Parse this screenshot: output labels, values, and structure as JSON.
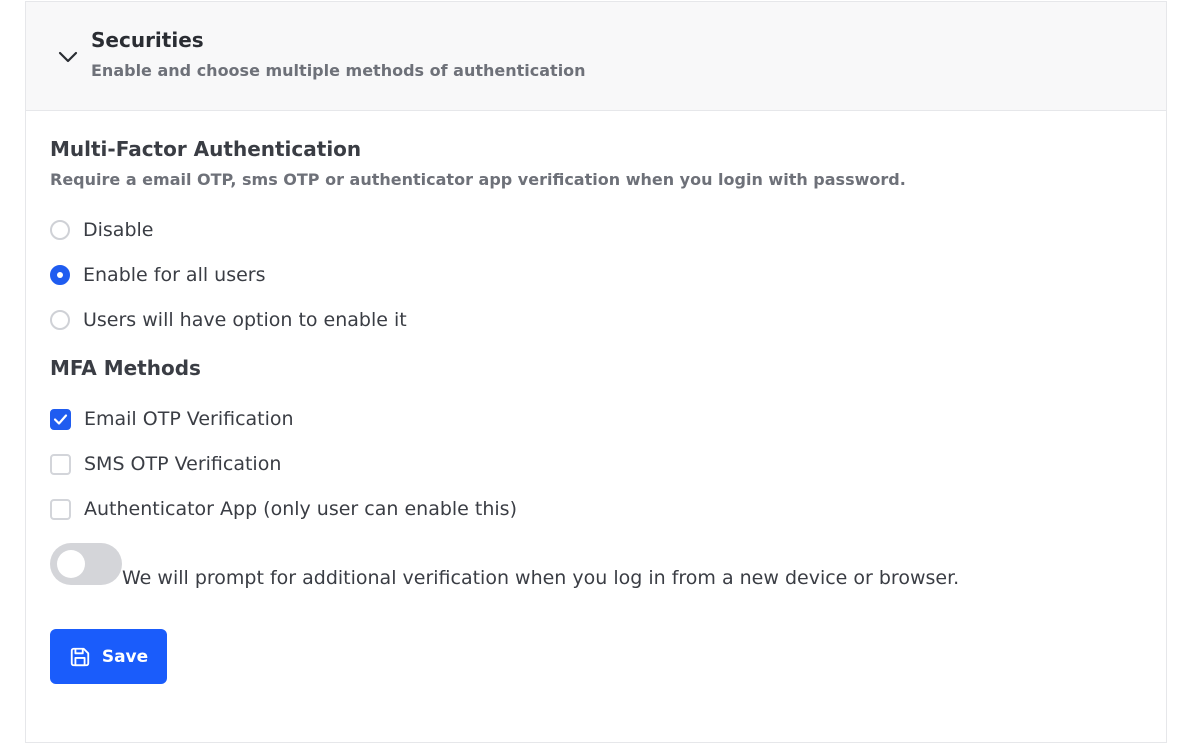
{
  "header": {
    "title": "Securities",
    "subtitle": "Enable and choose multiple methods of authentication",
    "icon": "chevron-down-icon"
  },
  "mfa": {
    "title": "Multi-Factor Authentication",
    "description": "Require a email OTP, sms OTP or authenticator app verification when you login with password.",
    "options": [
      {
        "label": "Disable",
        "selected": false
      },
      {
        "label": "Enable for all users",
        "selected": true
      },
      {
        "label": "Users will have option to enable it",
        "selected": false
      }
    ]
  },
  "methods": {
    "title": "MFA Methods",
    "items": [
      {
        "label": "Email OTP Verification",
        "checked": true
      },
      {
        "label": "SMS OTP Verification",
        "checked": false
      },
      {
        "label": "Authenticator App (only user can enable this)",
        "checked": false
      }
    ]
  },
  "toggle": {
    "label": "We will prompt for additional verification when you log in from a new device or browser.",
    "on": false
  },
  "save": {
    "label": "Save",
    "icon": "save-icon"
  },
  "colors": {
    "accent": "#1a5cfb",
    "header_bg": "#f8f8f9",
    "toggle_off": "#d4d5d9"
  }
}
